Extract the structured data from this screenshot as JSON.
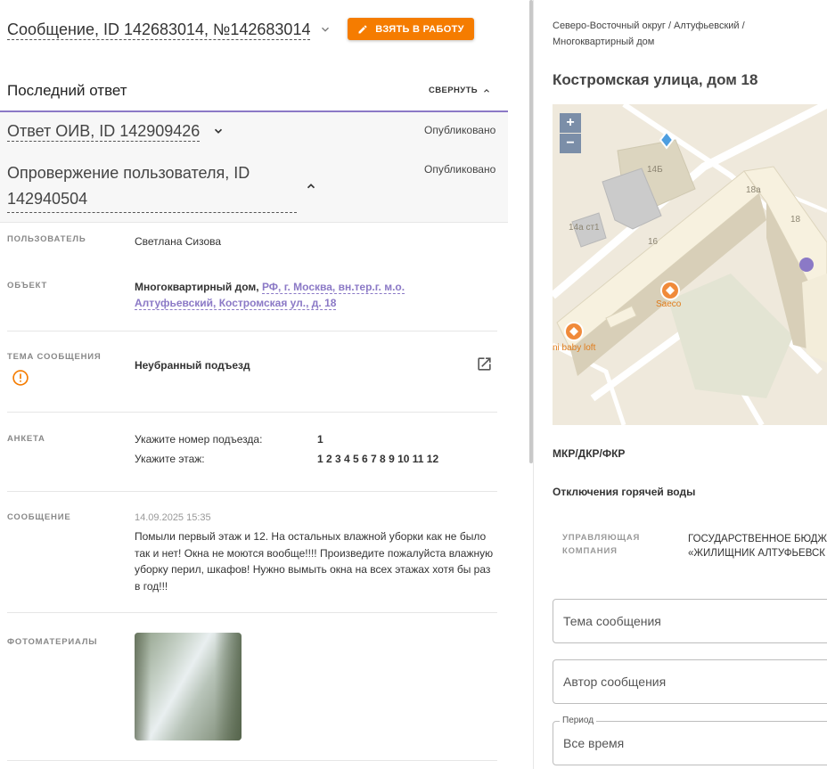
{
  "header": {
    "message_title": "Сообщение, ID 142683014, №142683014",
    "take_button": "ВЗЯТЬ В РАБОТУ"
  },
  "answers": {
    "section_title": "Последний ответ",
    "collapse_label": "СВЕРНУТЬ",
    "oiv_answer_title": "Ответ ОИВ, ID 142909426",
    "oiv_status": "Опубликовано",
    "refutation_title": "Опровержение пользователя, ID 142940504",
    "refutation_status": "Опубликовано"
  },
  "details": {
    "user_label": "ПОЛЬЗОВАТЕЛЬ",
    "user_value": "Светлана Сизова",
    "object_label": "ОБЪЕКТ",
    "object_type": "Многоквартирный дом,",
    "object_link": "РФ, г. Москва, вн.тер.г. м.о. Алтуфьевский, Костромская ул., д. 18",
    "topic_label": "ТЕМА СООБЩЕНИЯ",
    "topic_value": "Неубранный подъезд",
    "form_label": "АНКЕТА",
    "form_q1": "Укажите номер подъезда:",
    "form_a1": "1",
    "form_q2": "Укажите этаж:",
    "form_a2": "1 2 3 4 5 6 7 8 9 10 11 12",
    "message_label": "СООБЩЕНИЕ",
    "message_date": "14.09.2025 15:35",
    "message_text": "Помыли первый этаж и 12. На остальных влажной уборки как не было так и нет! Окна не моются вообще!!!! Произведите пожалуйста влажную уборку перил, шкафов! Нужно вымыть окна на всех этажах хотя бы раз в год!!!",
    "photos_label": "ФОТОМАТЕРИАЛЫ"
  },
  "right": {
    "breadcrumb": "Северо-Восточный округ / Алтуфьевский / Многоквартирный дом",
    "address": "Костромская улица, дом 18",
    "map": {
      "zoom_in": "+",
      "zoom_out": "−",
      "labels": [
        "14Б",
        "14а ст1",
        "16",
        "18а",
        "18"
      ],
      "poi_saeco": "Saeco",
      "poi_baby": "ni baby loft"
    },
    "mkr": "МКР/ДКР/ФКР",
    "hot_water": "Отключения горячей воды",
    "uk_label": "УПРАВЛЯЮЩАЯ КОМПАНИЯ",
    "uk_value_line1": "ГОСУДАРСТВЕННОЕ БЮДЖ",
    "uk_value_line2": "«ЖИЛИЩНИК АЛТУФЬЕВСК",
    "topic_placeholder": "Тема сообщения",
    "author_placeholder": "Автор сообщения",
    "period_legend": "Период",
    "period_value": "Все время"
  },
  "colors": {
    "accent_orange": "#f57c00",
    "accent_purple": "#8b79c6"
  }
}
